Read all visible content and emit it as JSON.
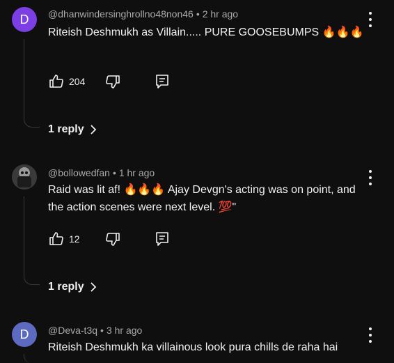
{
  "comments": [
    {
      "author": "@dhanwindersinghrollno48non46",
      "time": "2 hr ago",
      "avatar_letter": "D",
      "avatar_color": "#7b3fe4",
      "text": "Riteish Deshmukh as Villain.....  PURE GOOSEBUMPS 🔥🔥🔥",
      "likes": "204",
      "reply_label": "1 reply"
    },
    {
      "author": "@bollowedfan",
      "time": "1 hr ago",
      "avatar_letter": "",
      "avatar_color": "#3a3a3a",
      "text": "Raid was lit af! 🔥🔥🔥 Ajay Devgn's acting was on point, and the action scenes were next level. 💯\"",
      "likes": "12",
      "reply_label": "1 reply"
    },
    {
      "author": "@Deva-t3q",
      "time": "3 hr ago",
      "avatar_letter": "D",
      "avatar_color": "#5c6bc0",
      "text": "Riteish Deshmukh ka villainous look pura chills de raha hai"
    }
  ],
  "meta_separator": "•",
  "icons": {
    "like": "thumb-up-icon",
    "dislike": "thumb-down-icon",
    "reply": "comment-reply-icon",
    "more": "more-vert-icon",
    "chevron": "chevron-right-icon"
  }
}
